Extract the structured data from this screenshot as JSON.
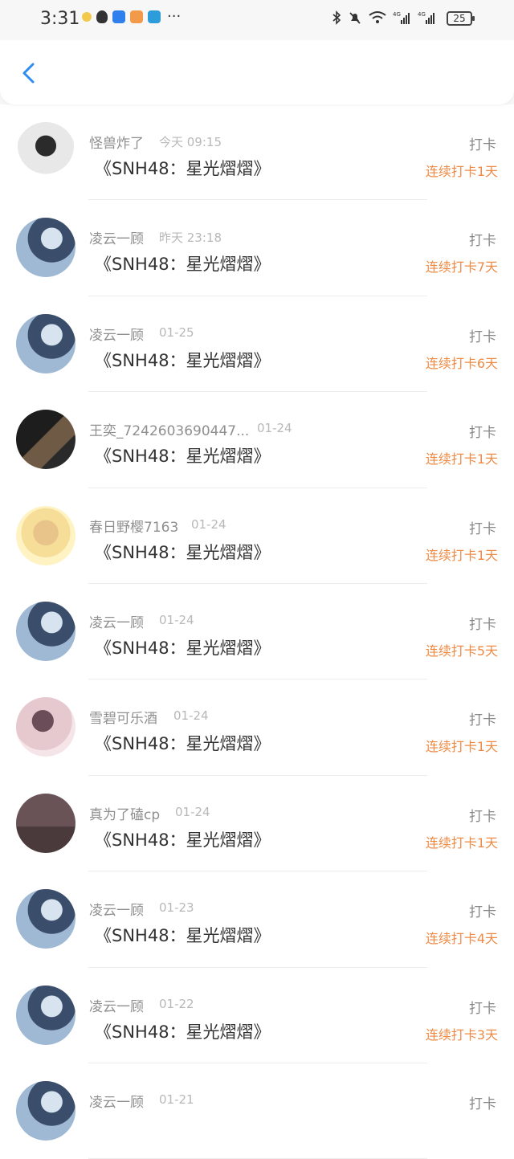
{
  "status_bar": {
    "time": "3:31",
    "battery": "25",
    "icons": [
      "bt-icon",
      "mute-icon",
      "wifi-icon",
      "signal-4g-icon",
      "signal-4g-icon",
      "battery-icon"
    ]
  },
  "header": {
    "back_icon": "chevron-left-icon"
  },
  "entries": [
    {
      "name": "怪兽炸了",
      "time": "今天 09:15",
      "title": "《SNH48：星光熠熠》",
      "punch": "打卡",
      "streak": "连续打卡1天"
    },
    {
      "name": "凌云一顾",
      "time": "昨天 23:18",
      "title": "《SNH48：星光熠熠》",
      "punch": "打卡",
      "streak": "连续打卡7天"
    },
    {
      "name": "凌云一顾",
      "time": "01-25",
      "title": "《SNH48：星光熠熠》",
      "punch": "打卡",
      "streak": "连续打卡6天"
    },
    {
      "name": "王奕_7242603690447...",
      "time": "01-24",
      "title": "《SNH48：星光熠熠》",
      "punch": "打卡",
      "streak": "连续打卡1天"
    },
    {
      "name": "春日野樱7163",
      "time": "01-24",
      "title": "《SNH48：星光熠熠》",
      "punch": "打卡",
      "streak": "连续打卡1天"
    },
    {
      "name": "凌云一顾",
      "time": "01-24",
      "title": "《SNH48：星光熠熠》",
      "punch": "打卡",
      "streak": "连续打卡5天"
    },
    {
      "name": "雪碧可乐酒",
      "time": "01-24",
      "title": "《SNH48：星光熠熠》",
      "punch": "打卡",
      "streak": "连续打卡1天"
    },
    {
      "name": "真为了磕cp",
      "time": "01-24",
      "title": "《SNH48：星光熠熠》",
      "punch": "打卡",
      "streak": "连续打卡1天"
    },
    {
      "name": "凌云一顾",
      "time": "01-23",
      "title": "《SNH48：星光熠熠》",
      "punch": "打卡",
      "streak": "连续打卡4天"
    },
    {
      "name": "凌云一顾",
      "time": "01-22",
      "title": "《SNH48：星光熠熠》",
      "punch": "打卡",
      "streak": "连续打卡3天"
    },
    {
      "name": "凌云一顾",
      "time": "01-21",
      "title": "",
      "punch": "打卡",
      "streak": ""
    }
  ],
  "colors": {
    "accent": "#2d8cf0",
    "streak": "#ef8a44",
    "name": "#8f8f8f",
    "time": "#b8b8b8"
  }
}
